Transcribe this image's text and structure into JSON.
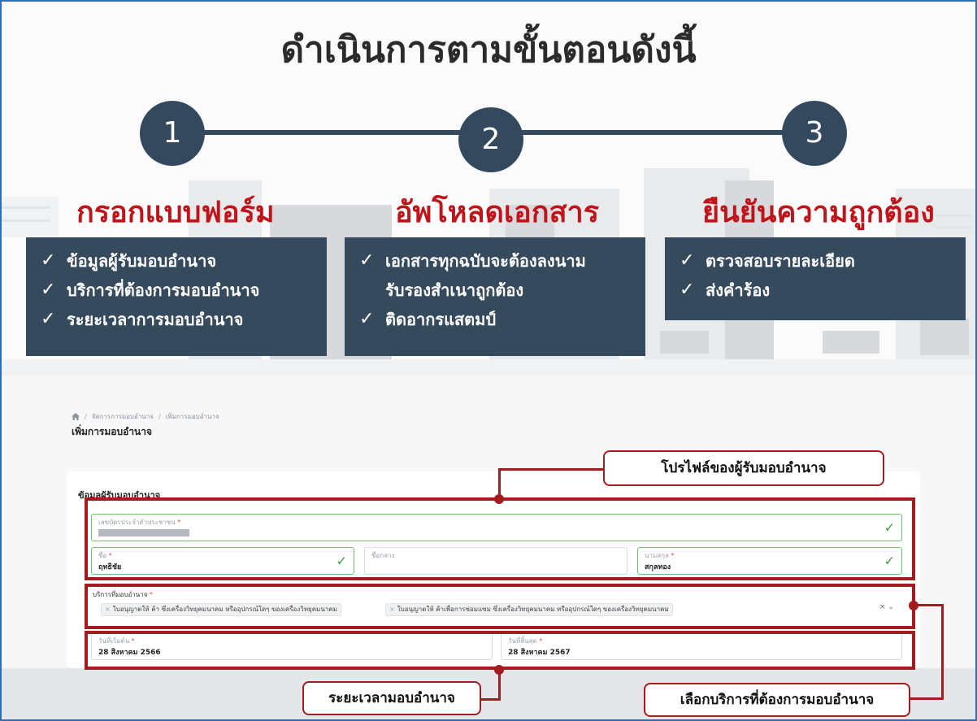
{
  "heading": "ดำเนินการตามขั้นตอนดังนี้",
  "steps": [
    {
      "number": "1",
      "title": "กรอกแบบฟอร์ม",
      "items": [
        "ข้อมูลผู้รับมอบอำนาจ",
        "บริการที่ต้องการมอบอำนาจ",
        "ระยะเวลาการมอบอำนาจ"
      ]
    },
    {
      "number": "2",
      "title": "อัพโหลดเอกสาร",
      "items": [
        "เอกสารทุกฉบับจะต้องลงนาม",
        "รับรองสำเนาถูกต้อง",
        "ติดอากรแสตมป์"
      ]
    },
    {
      "number": "3",
      "title": "ยืนยันความถูกต้อง",
      "items": [
        "ตรวจสอบรายละเอียด",
        "ส่งคำร้อง"
      ]
    }
  ],
  "check_glyph": "✓",
  "form": {
    "breadcrumb": [
      "จัดการการมอบอำนาจ",
      "เพิ่มการมอบอำนาจ"
    ],
    "breadcrumb_sep": "/",
    "page_title": "เพิ่มการมอบอำนาจ",
    "card_title": "ข้อมูลผู้รับมอบอำนาจ",
    "id_field_label": "เลขบัตรประจำตัวประชาชน",
    "first_name_label": "ชื่อ",
    "first_name_value": "ฤทธิชัย",
    "middle_name_label": "ชื่อกลาง",
    "last_name_label": "นามสกุล",
    "last_name_value": "สกุลทอง",
    "required_mark": "*",
    "service_label": "บริการที่มอบอำนาจ",
    "service_chips": [
      "ใบอนุญาตให้ ค้า ซึ่งเครื่องวิทยุคมนาคม หรืออุปกรณ์ใดๆ ของเครื่องวิทยุคมนาคม",
      "ใบอนุญาตให้ ค้าเพื่อการซ่อมแซม ซึ่งเครื่องวิทยุคมนาคม หรืออุปกรณ์ใดๆ ของเครื่องวิทยุคมนาคม"
    ],
    "chip_remove": "×",
    "select_controls": "× ⌄",
    "start_label": "วันที่เริ่มต้น",
    "start_value": "28 สิงหาคม 2566",
    "end_label": "วันที่สิ้นสุด",
    "end_value": "28 สิงหาคม 2567",
    "valid_tick": "✓"
  },
  "callouts": {
    "profile": "โปรไฟล์ของผู้รับมอบอำนาจ",
    "period": "ระยะเวลามอบอำนาจ",
    "service": "เลือกบริการที่ต้องการมอบอำนาจ"
  },
  "colors": {
    "accent_red": "#a51c20",
    "title_red": "#c0141b",
    "panel": "#364a5d",
    "frame": "#2f6fb5"
  }
}
